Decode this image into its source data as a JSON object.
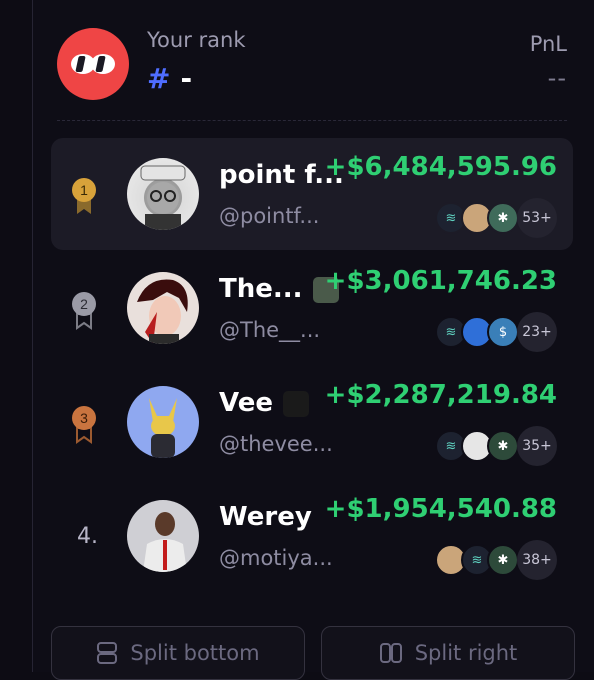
{
  "header": {
    "rank_label": "Your rank",
    "rank_hash": "#",
    "rank_value": "-",
    "pnl_label": "PnL",
    "pnl_value": "--"
  },
  "leaderboard": [
    {
      "rank": "1",
      "rank_style": "gold",
      "name": "point f...",
      "handle": "@pointf...",
      "pnl": "+$6,484,595.96",
      "more": "53+",
      "active": true
    },
    {
      "rank": "2",
      "rank_style": "silver",
      "name": "The...",
      "handle": "@The__...",
      "pnl": "+$3,061,746.23",
      "more": "23+",
      "active": false
    },
    {
      "rank": "3",
      "rank_style": "bronze",
      "name": "Vee",
      "handle": "@thevee...",
      "pnl": "+$2,287,219.84",
      "more": "35+",
      "active": false
    },
    {
      "rank": "4.",
      "rank_style": "plain",
      "name": "Werey",
      "handle": "@motiya...",
      "pnl": "+$1,954,540.88",
      "more": "38+",
      "active": false
    }
  ],
  "buttons": {
    "split_bottom": "Split bottom",
    "split_right": "Split right"
  },
  "colors": {
    "accent_red": "#ef4545",
    "profit_green": "#2fcf73",
    "hash_blue": "#4f6dff",
    "gold": "#d8a23a",
    "silver": "#9a9aa6",
    "bronze": "#c9743f"
  }
}
